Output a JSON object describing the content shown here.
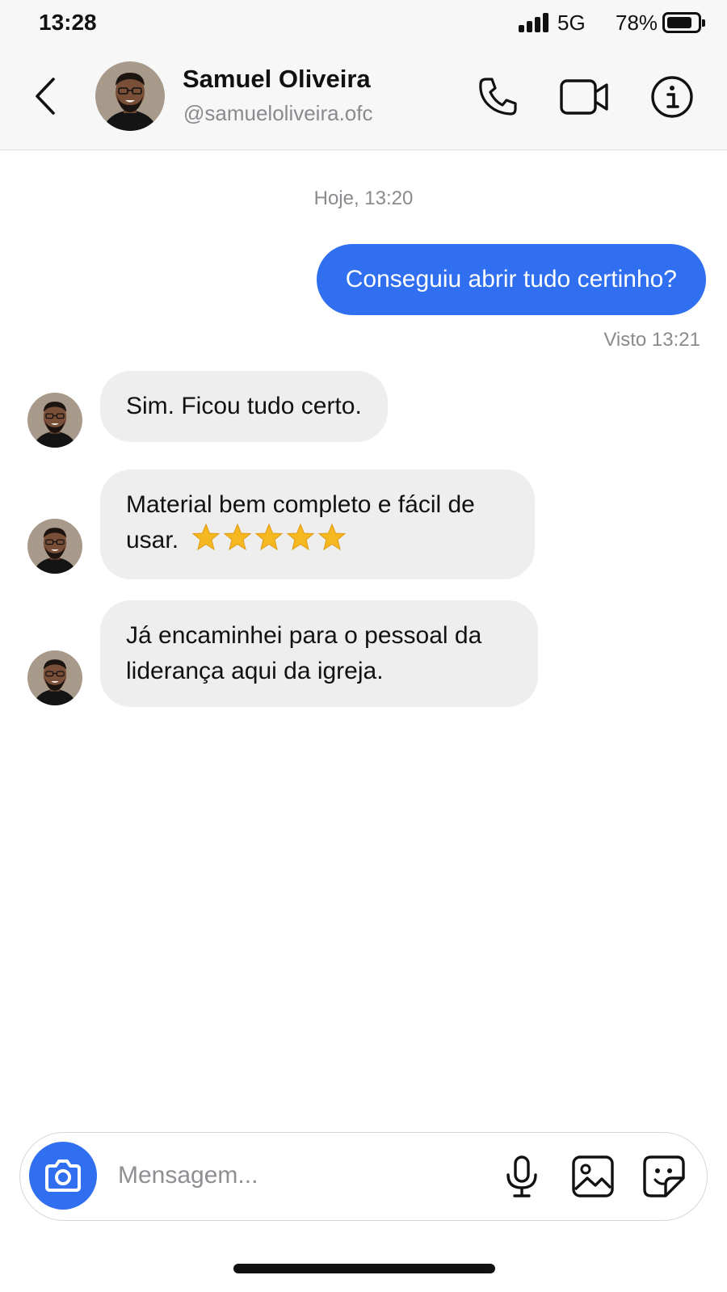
{
  "status_bar": {
    "time": "13:28",
    "network": "5G",
    "battery_percent": "78%",
    "battery_level": 0.78
  },
  "header": {
    "name": "Samuel Oliveira",
    "handle": "@samueloliveira.ofc",
    "icons": [
      "back-arrow-icon",
      "phone-icon",
      "video-camera-icon",
      "info-icon"
    ]
  },
  "chat": {
    "day_separator": "Hoje, 13:20",
    "messages": [
      {
        "direction": "outgoing",
        "text": "Conseguiu abrir tudo certinho?",
        "status": "Visto 13:21"
      },
      {
        "direction": "incoming",
        "text": "Sim. Ficou tudo certo."
      },
      {
        "direction": "incoming",
        "lines": [
          "Material bem completo e fácil de",
          "usar."
        ],
        "rating_stars": 5
      },
      {
        "direction": "incoming",
        "lines": [
          "Já encaminhei para o pessoal da",
          "liderança aqui da igreja."
        ]
      }
    ]
  },
  "composer": {
    "placeholder": "Mensagem...",
    "icons": [
      "camera-icon",
      "microphone-icon",
      "gallery-icon",
      "sticker-icon"
    ]
  },
  "colors": {
    "accent": "#2f6ff0",
    "incoming_bubble": "#eeeeef",
    "muted_text": "#8a8a8f",
    "star": "#f5b821"
  }
}
